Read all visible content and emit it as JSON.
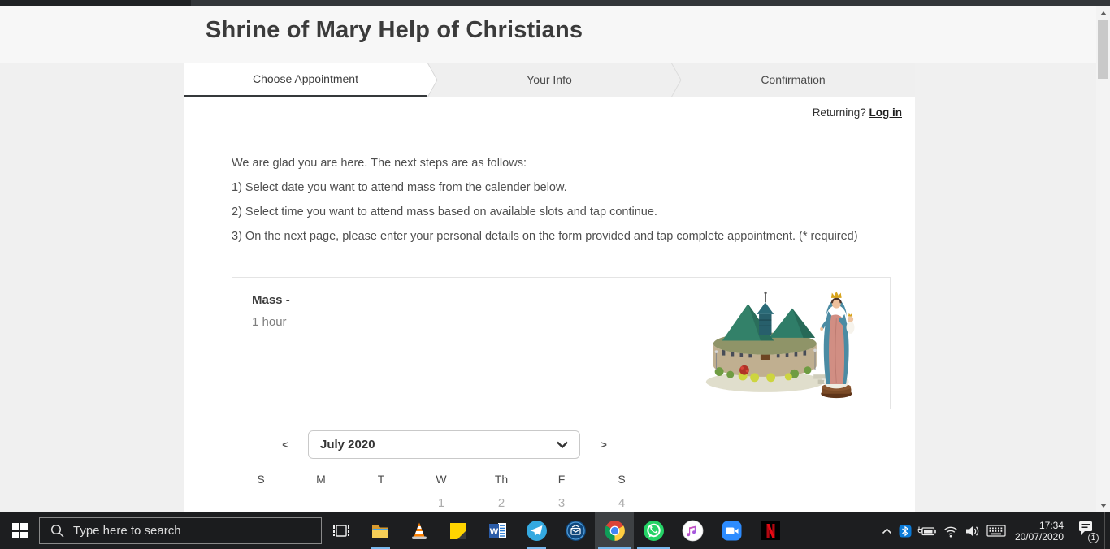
{
  "colors": {
    "topbar_bg": "#33363a",
    "hero_bg": "#f7f7f7",
    "page_bg": "#f0f0f0",
    "tab_active_underline": "#35393b",
    "taskbar_bg": "#1d1e20",
    "taskbar_accent_underline": "#79b8ed",
    "date_disabled": "#adadad"
  },
  "page": {
    "title": "Shrine of Mary Help of Christians",
    "tabs": [
      {
        "label": "Choose Appointment",
        "active": true
      },
      {
        "label": "Your Info",
        "active": false
      },
      {
        "label": "Confirmation",
        "active": false
      }
    ],
    "returning": {
      "text": "Returning?",
      "link": "Log in"
    },
    "instructions": [
      "We are glad you are here. The next steps are as follows:",
      "1) Select date you want to attend mass from the calender below.",
      "2) Select time you want to attend mass based on available slots and tap continue.",
      "3) On the next page, please enter your personal details on the form provided and tap complete appointment. (* required)"
    ],
    "service": {
      "name": "Mass -",
      "duration": "1 hour",
      "image": "church-and-mary-statue"
    },
    "calendar": {
      "prev": "<",
      "next": ">",
      "month": "July 2020",
      "weekdays": [
        "S",
        "M",
        "T",
        "W",
        "Th",
        "F",
        "S"
      ],
      "first_row_dates": [
        "",
        "",
        "",
        "1",
        "2",
        "3",
        "4"
      ]
    }
  },
  "taskbar": {
    "search_placeholder": "Type here to search",
    "pinned_apps": [
      "task-view",
      "file-explorer",
      "vlc",
      "sticky-notes",
      "word",
      "telegram",
      "mail",
      "chrome",
      "whatsapp",
      "itunes",
      "zoom",
      "netflix"
    ],
    "running_apps": [
      "file-explorer",
      "telegram",
      "chrome",
      "whatsapp"
    ],
    "active_app": "chrome",
    "tray_icons": [
      "hidden-icons-chevron",
      "bluetooth",
      "battery-charging",
      "wifi",
      "volume",
      "touch-keyboard"
    ],
    "clock": {
      "time": "17:34",
      "date": "20/07/2020"
    },
    "notifications": {
      "badge": "1"
    }
  }
}
